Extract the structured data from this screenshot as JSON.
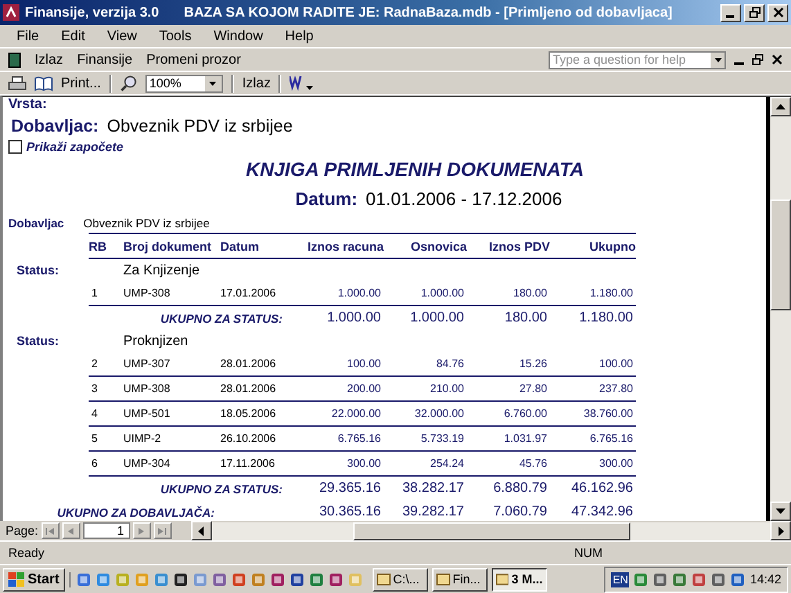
{
  "window": {
    "app_title": "Finansije, verzija 3.0",
    "title": "BAZA SA KOJOM RADITE JE: RadnaBaza.mdb - [Primljeno od dobavljaca]"
  },
  "menu": [
    "File",
    "Edit",
    "View",
    "Tools",
    "Window",
    "Help"
  ],
  "help_search": {
    "placeholder": "Type a question for help"
  },
  "toolbar1": [
    "Izlaz",
    "Finansije",
    "Promeni prozor"
  ],
  "toolbar2": {
    "print": "Print...",
    "zoom": "100%",
    "exit": "Izlaz"
  },
  "report": {
    "vrsta_label": "Vrsta:",
    "supplier_label": "Dobavljac:",
    "supplier": "Obveznik PDV iz srbijee",
    "show_started": {
      "label": "Prikaži započete",
      "checked": false
    },
    "title": "KNJIGA PRIMLJENIH DOKUMENATA",
    "date_label": "Datum:",
    "date_range": "01.01.2006 - 17.12.2006",
    "supplier_label_2": "Dobavljac",
    "supplier_2": "Obveznik PDV iz srbijee",
    "columns": [
      "RB",
      "Broj dokument",
      "Datum",
      "Iznos racuna",
      "Osnovica",
      "Iznos PDV",
      "Ukupno"
    ],
    "groups": [
      {
        "label": "Status:",
        "status": "Za Knjizenje",
        "rows": [
          [
            "1",
            "UMP-308",
            "17.01.2006",
            "1.000.00",
            "1.000.00",
            "180.00",
            "1.180.00"
          ]
        ],
        "total_label": "UKUPNO ZA STATUS:",
        "totals": [
          "1.000.00",
          "1.000.00",
          "180.00",
          "1.180.00"
        ]
      },
      {
        "label": "Status:",
        "status": "Proknjizen",
        "rows": [
          [
            "2",
            "UMP-307",
            "28.01.2006",
            "100.00",
            "84.76",
            "15.26",
            "100.00"
          ],
          [
            "3",
            "UMP-308",
            "28.01.2006",
            "200.00",
            "210.00",
            "27.80",
            "237.80"
          ],
          [
            "4",
            "UMP-501",
            "18.05.2006",
            "22.000.00",
            "32.000.00",
            "6.760.00",
            "38.760.00"
          ],
          [
            "5",
            "UIMP-2",
            "26.10.2006",
            "6.765.16",
            "5.733.19",
            "1.031.97",
            "6.765.16"
          ],
          [
            "6",
            "UMP-304",
            "17.11.2006",
            "300.00",
            "254.24",
            "45.76",
            "300.00"
          ]
        ],
        "total_label": "UKUPNO ZA STATUS:",
        "totals": [
          "29.365.16",
          "38.282.17",
          "6.880.79",
          "46.162.96"
        ]
      }
    ],
    "grand_total_label": "UKUPNO ZA DOBAVLJAČA:",
    "grand_totals": [
      "30.365.16",
      "39.282.17",
      "7.060.79",
      "47.342.96"
    ]
  },
  "pager": {
    "label": "Page:",
    "page": "1"
  },
  "status_bar": {
    "text": "Ready",
    "num": "NUM"
  },
  "taskbar": {
    "start": "Start",
    "tasks": [
      {
        "label": "C:\\...",
        "selected": false
      },
      {
        "label": "Fin...",
        "selected": false
      },
      {
        "label": "3 M...",
        "selected": true
      }
    ],
    "lang": "EN",
    "clock": "14:42"
  }
}
